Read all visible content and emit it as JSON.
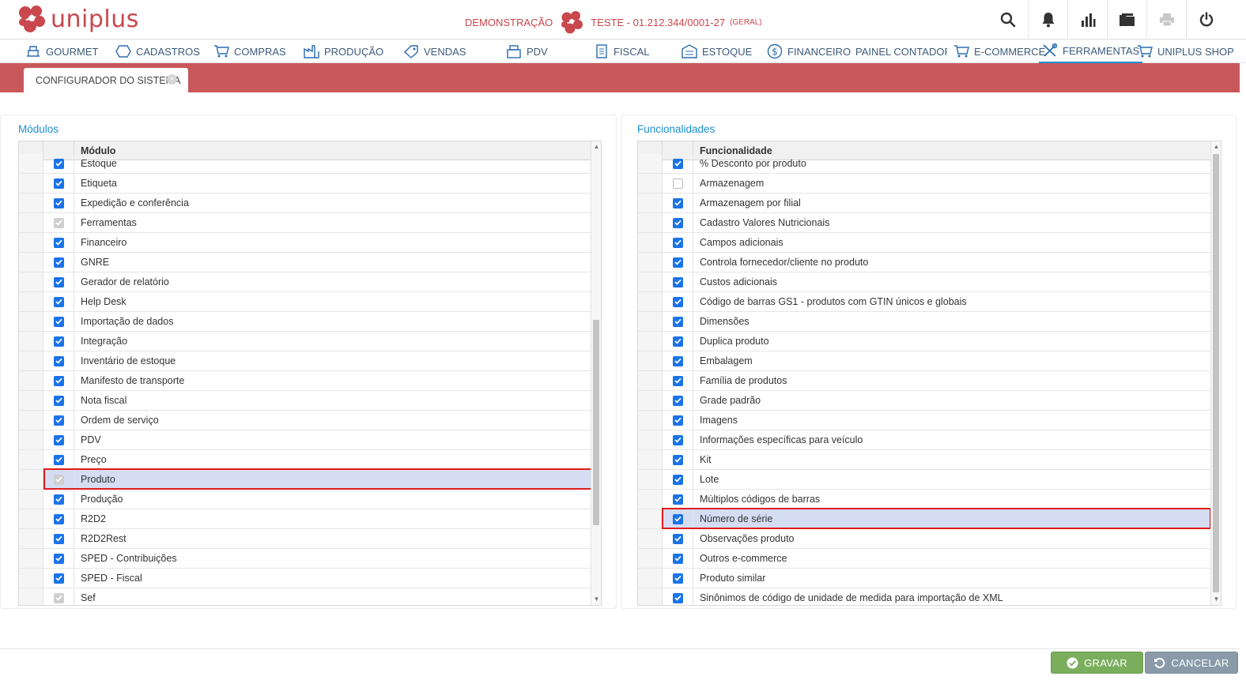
{
  "app": {
    "logo_text": "uniplus"
  },
  "header": {
    "demo_label": "DEMONSTRAÇÃO",
    "company": "TESTE - 01.212.344/0001-27",
    "company_suffix": "(GERAL)",
    "icons": [
      "search-icon",
      "bell-icon",
      "chart-icon",
      "folder-icon",
      "print-icon",
      "power-icon"
    ]
  },
  "nav": {
    "items": [
      {
        "label": "GOURMET",
        "icon": "gourmet-icon"
      },
      {
        "label": "CADASTROS",
        "icon": "cube-icon"
      },
      {
        "label": "COMPRAS",
        "icon": "cart-icon"
      },
      {
        "label": "PRODUÇÃO",
        "icon": "factory-icon"
      },
      {
        "label": "VENDAS",
        "icon": "tag-icon"
      },
      {
        "label": "PDV",
        "icon": "register-icon"
      },
      {
        "label": "FISCAL",
        "icon": "document-icon"
      },
      {
        "label": "ESTOQUE",
        "icon": "warehouse-icon"
      },
      {
        "label": "FINANCEIRO",
        "icon": "dollar-icon"
      },
      {
        "label": "PAINEL CONTADOR",
        "icon": "clipboard-icon"
      },
      {
        "label": "E-COMMERCE",
        "icon": "cart-icon"
      },
      {
        "label": "FERRAMENTAS",
        "icon": "tools-icon"
      },
      {
        "label": "UNIPLUS SHOP",
        "icon": "cart-icon"
      }
    ],
    "active": "FERRAMENTAS"
  },
  "tab": {
    "label": "CONFIGURADOR DO SISTEMA"
  },
  "modules": {
    "title": "Módulos",
    "column": "Módulo",
    "rows": [
      {
        "label": "Estoque",
        "state": "checked"
      },
      {
        "label": "Etiqueta",
        "state": "checked"
      },
      {
        "label": "Expedição e conferência",
        "state": "checked"
      },
      {
        "label": "Ferramentas",
        "state": "disabled"
      },
      {
        "label": "Financeiro",
        "state": "checked"
      },
      {
        "label": "GNRE",
        "state": "checked"
      },
      {
        "label": "Gerador de relatório",
        "state": "checked"
      },
      {
        "label": "Help Desk",
        "state": "checked"
      },
      {
        "label": "Importação de dados",
        "state": "checked"
      },
      {
        "label": "Integração",
        "state": "checked"
      },
      {
        "label": "Inventário de estoque",
        "state": "checked"
      },
      {
        "label": "Manifesto de transporte",
        "state": "checked"
      },
      {
        "label": "Nota fiscal",
        "state": "checked"
      },
      {
        "label": "Ordem de serviço",
        "state": "checked"
      },
      {
        "label": "PDV",
        "state": "checked"
      },
      {
        "label": "Preço",
        "state": "checked"
      },
      {
        "label": "Produto",
        "state": "disabled",
        "selected": true
      },
      {
        "label": "Produção",
        "state": "checked"
      },
      {
        "label": "R2D2",
        "state": "checked"
      },
      {
        "label": "R2D2Rest",
        "state": "checked"
      },
      {
        "label": "SPED - Contribuições",
        "state": "checked"
      },
      {
        "label": "SPED - Fiscal",
        "state": "checked"
      },
      {
        "label": "Sef",
        "state": "disabled"
      }
    ]
  },
  "features": {
    "title": "Funcionalidades",
    "column": "Funcionalidade",
    "rows": [
      {
        "label": "% Desconto por produto",
        "state": "checked"
      },
      {
        "label": "Armazenagem",
        "state": "unchecked"
      },
      {
        "label": "Armazenagem por filial",
        "state": "checked"
      },
      {
        "label": "Cadastro Valores Nutricionais",
        "state": "checked"
      },
      {
        "label": "Campos adicionais",
        "state": "checked"
      },
      {
        "label": "Controla fornecedor/cliente no produto",
        "state": "checked"
      },
      {
        "label": "Custos adicionais",
        "state": "checked"
      },
      {
        "label": "Código de barras GS1 - produtos com GTIN únicos e globais",
        "state": "checked"
      },
      {
        "label": "Dimensões",
        "state": "checked"
      },
      {
        "label": "Duplica produto",
        "state": "checked"
      },
      {
        "label": "Embalagem",
        "state": "checked"
      },
      {
        "label": "Família de produtos",
        "state": "checked"
      },
      {
        "label": "Grade padrão",
        "state": "checked"
      },
      {
        "label": "Imagens",
        "state": "checked"
      },
      {
        "label": "Informações específicas para veículo",
        "state": "checked"
      },
      {
        "label": "Kit",
        "state": "checked"
      },
      {
        "label": "Lote",
        "state": "checked"
      },
      {
        "label": "Múltiplos códigos de barras",
        "state": "checked"
      },
      {
        "label": "Número de série",
        "state": "checked",
        "selected": true
      },
      {
        "label": "Observações produto",
        "state": "checked"
      },
      {
        "label": "Outros e-commerce",
        "state": "checked"
      },
      {
        "label": "Produto similar",
        "state": "checked"
      },
      {
        "label": "Sinônimos de código de unidade de medida para importação de XML",
        "state": "checked"
      }
    ]
  },
  "footer": {
    "save_label": "GRAVAR",
    "cancel_label": "CANCELAR"
  },
  "colors": {
    "brand": "#c9474d",
    "tabbar": "#c9585a",
    "accent": "#1b8fd1",
    "checkbox": "#1a73e8",
    "highlight": "#e01b1b",
    "save": "#7aae5c",
    "cancel": "#8a9aa8"
  }
}
